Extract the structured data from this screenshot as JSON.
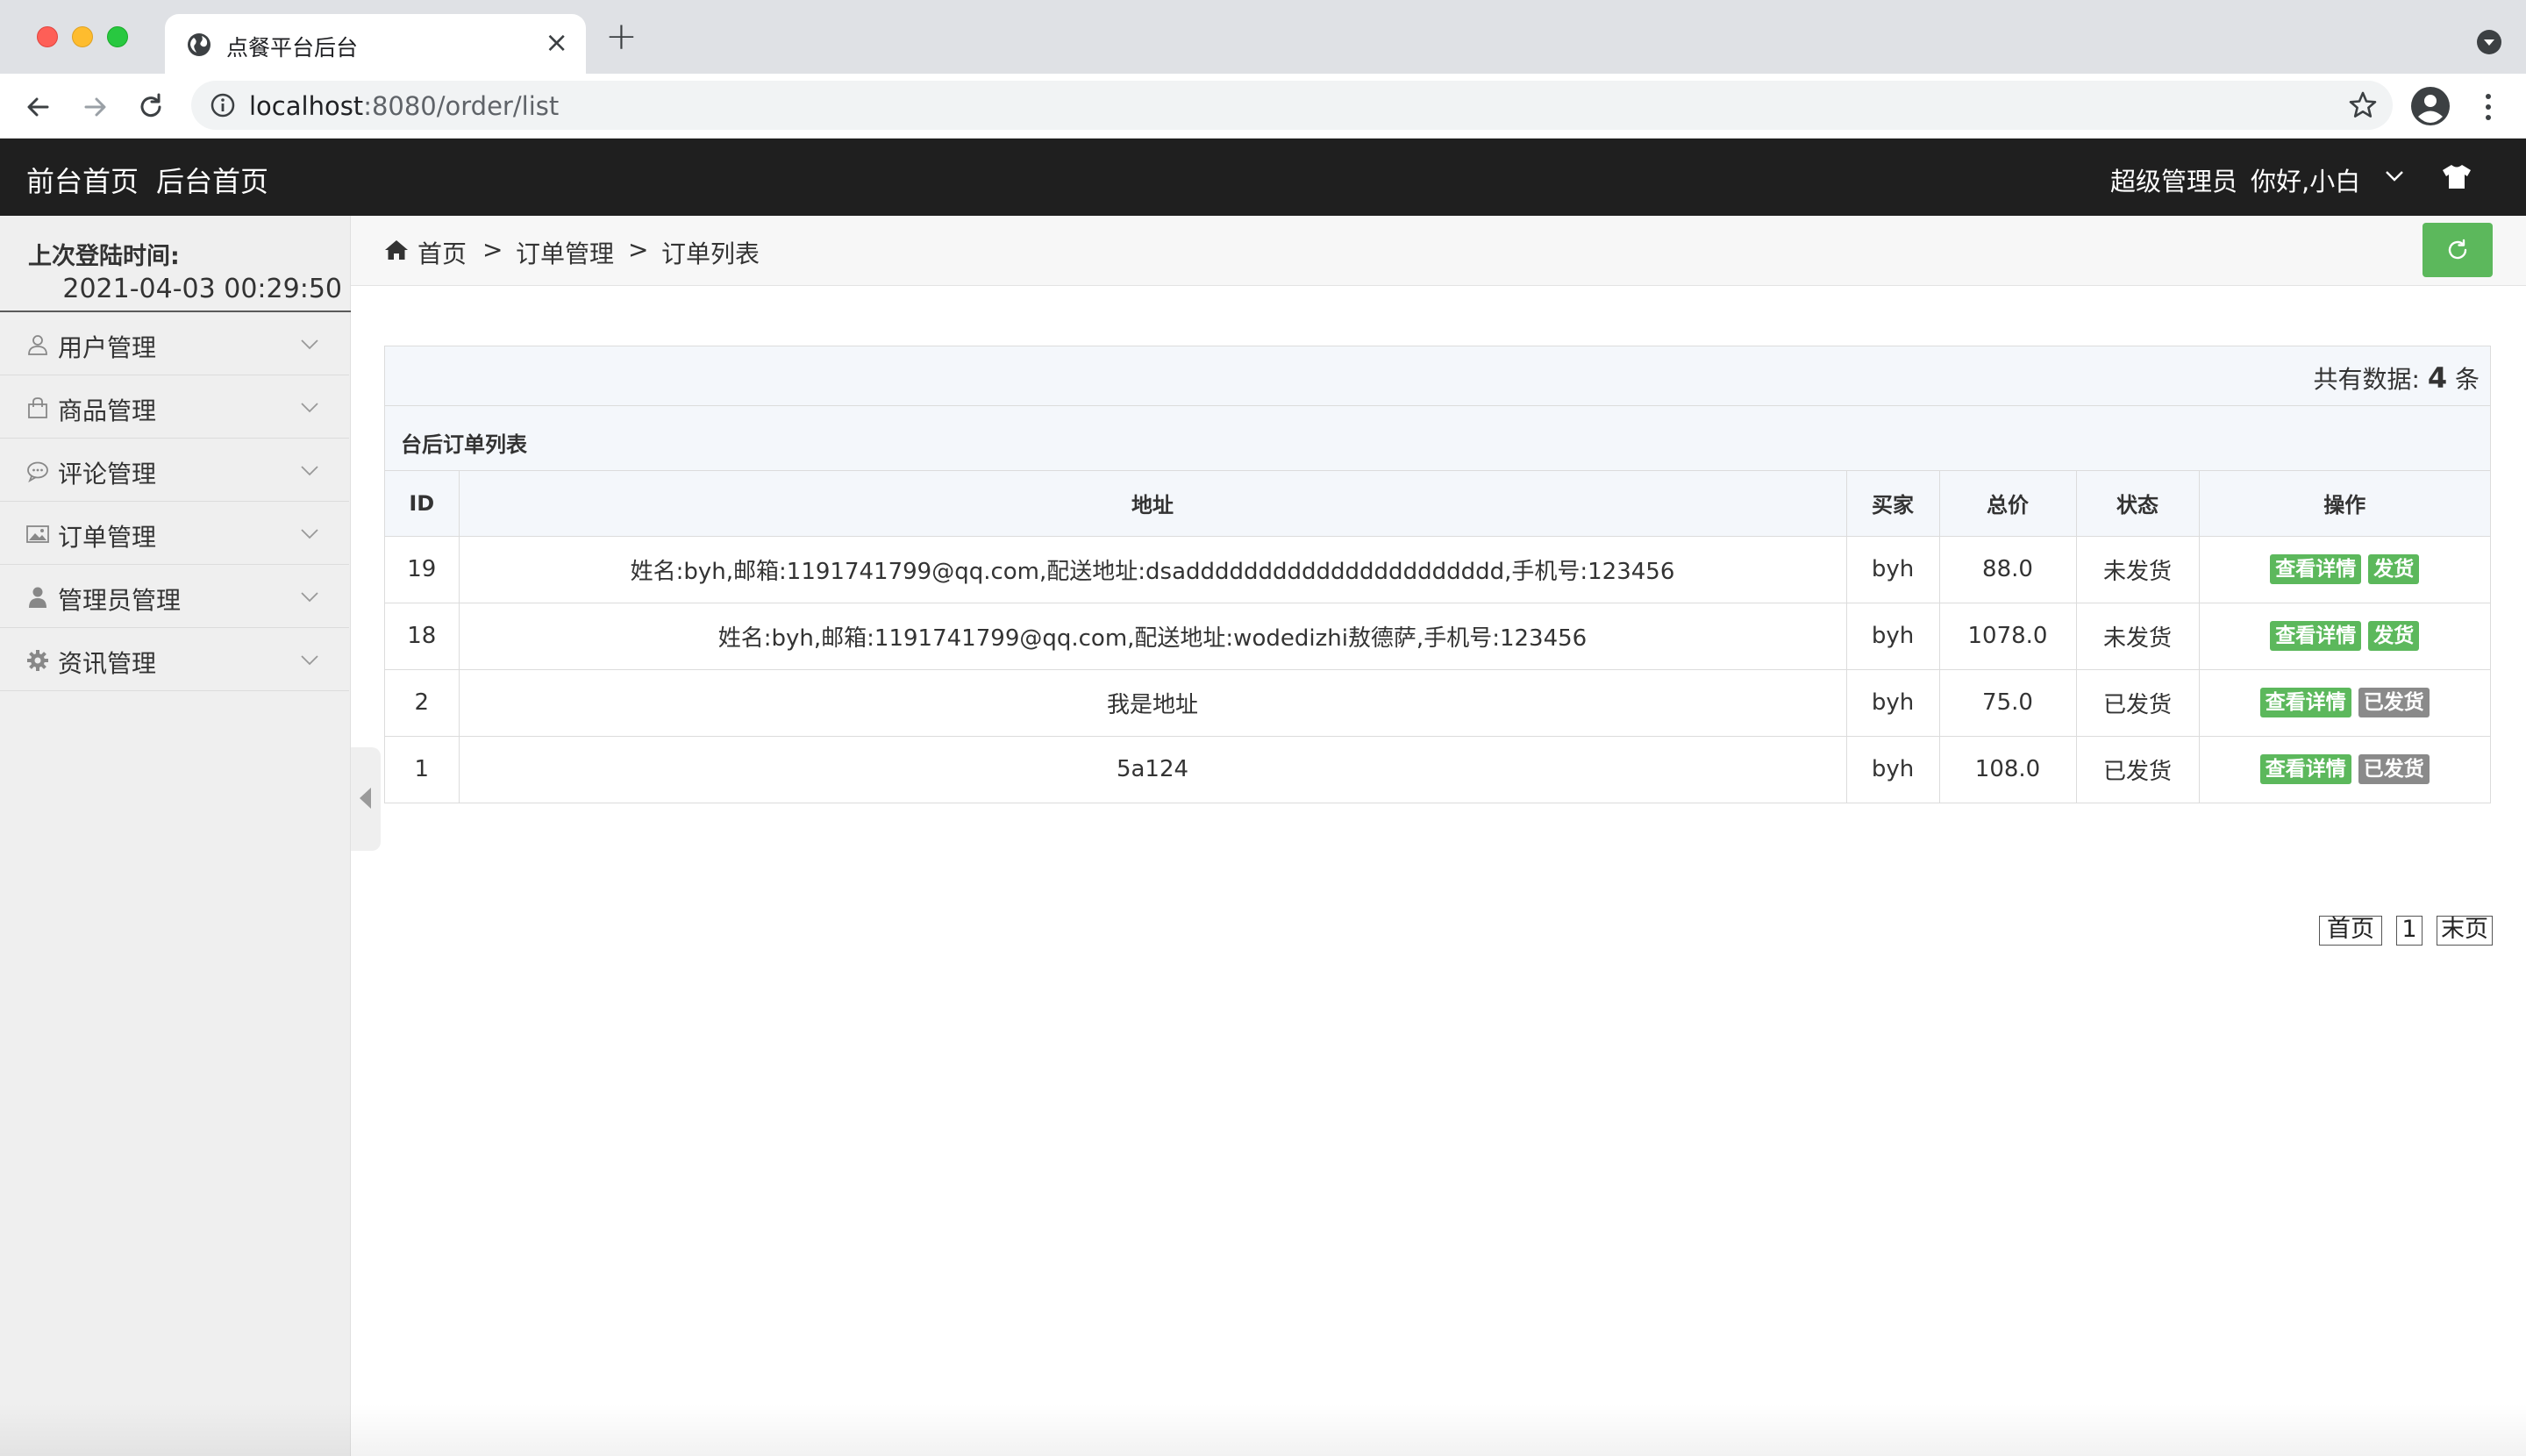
{
  "browser": {
    "tab_title": "点餐平台后台",
    "tab_close": "×",
    "new_tab": "+",
    "url_host": "localhost",
    "url_path": ":8080/order/list"
  },
  "header": {
    "front_home": "前台首页",
    "back_home": "后台首页",
    "role": "超级管理员",
    "greeting": "你好,小白"
  },
  "sidebar": {
    "login_label": "上次登陆时间:",
    "login_time": "2021-04-03 00:29:50",
    "items": [
      {
        "label": "用户管理",
        "icon": "user-icon"
      },
      {
        "label": "商品管理",
        "icon": "bag-icon"
      },
      {
        "label": "评论管理",
        "icon": "comment-icon"
      },
      {
        "label": "订单管理",
        "icon": "picture-icon"
      },
      {
        "label": "管理员管理",
        "icon": "person-icon"
      },
      {
        "label": "资讯管理",
        "icon": "gear-icon"
      }
    ]
  },
  "breadcrumb": {
    "home": "首页",
    "sep1": ">",
    "level2": "订单管理",
    "sep2": ">",
    "level3": "订单列表"
  },
  "panel": {
    "count_prefix": "共有数据:",
    "count_value": "4",
    "count_suffix": "条",
    "title": "台后订单列表",
    "columns": [
      "ID",
      "地址",
      "买家",
      "总价",
      "状态",
      "操作"
    ],
    "rows": [
      {
        "id": "19",
        "address": "姓名:byh,邮箱:1191741799@qq.com,配送地址:dsadddddddddddddddddddddd,手机号:123456",
        "buyer": "byh",
        "total": "88.0",
        "status": "未发货",
        "action1": "查看详情",
        "action2": "发货"
      },
      {
        "id": "18",
        "address": "姓名:byh,邮箱:1191741799@qq.com,配送地址:wodedizhi敖德萨,手机号:123456",
        "buyer": "byh",
        "total": "1078.0",
        "status": "未发货",
        "action1": "查看详情",
        "action2": "发货"
      },
      {
        "id": "2",
        "address": "我是地址",
        "buyer": "byh",
        "total": "75.0",
        "status": "已发货",
        "action1": "查看详情",
        "action2": "已发货"
      },
      {
        "id": "1",
        "address": "5a124",
        "buyer": "byh",
        "total": "108.0",
        "status": "已发货",
        "action1": "查看详情",
        "action2": "已发货"
      }
    ]
  },
  "pager": {
    "first": "首页",
    "page1": "1",
    "last": "末页"
  },
  "colors": {
    "header_bg": "#1f1f1f",
    "accent_green": "#5cb85c",
    "shipped_gray": "#8a8a8a"
  }
}
